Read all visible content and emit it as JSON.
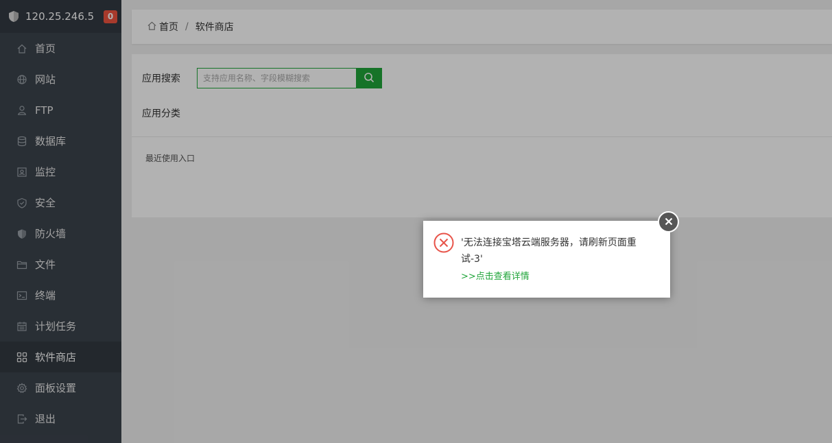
{
  "sidebar": {
    "ip": "120.25.246.5",
    "badge": "0",
    "items": [
      {
        "label": "首页",
        "icon": "home-icon"
      },
      {
        "label": "网站",
        "icon": "globe-icon"
      },
      {
        "label": "FTP",
        "icon": "ftp-icon"
      },
      {
        "label": "数据库",
        "icon": "database-icon"
      },
      {
        "label": "监控",
        "icon": "monitor-icon"
      },
      {
        "label": "安全",
        "icon": "shield-check-icon"
      },
      {
        "label": "防火墙",
        "icon": "firewall-icon"
      },
      {
        "label": "文件",
        "icon": "folder-icon"
      },
      {
        "label": "终端",
        "icon": "terminal-icon"
      },
      {
        "label": "计划任务",
        "icon": "calendar-icon"
      },
      {
        "label": "软件商店",
        "icon": "apps-icon",
        "active": true
      },
      {
        "label": "面板设置",
        "icon": "gear-icon"
      },
      {
        "label": "退出",
        "icon": "logout-icon"
      }
    ]
  },
  "breadcrumb": {
    "home": "首页",
    "separator": "/",
    "current": "软件商店"
  },
  "store": {
    "search_label": "应用搜索",
    "search_placeholder": "支持应用名称、字段模糊搜索",
    "category_label": "应用分类",
    "recent_label": "最近使用入口"
  },
  "dialog": {
    "message": "'无法连接宝塔云端服务器，请刷新页面重试-3'",
    "link": ">>点击查看详情"
  },
  "colors": {
    "accent": "#20a53a",
    "sidebar_bg": "#3c444d",
    "badge": "#f0533f",
    "error": "#e8544a"
  }
}
